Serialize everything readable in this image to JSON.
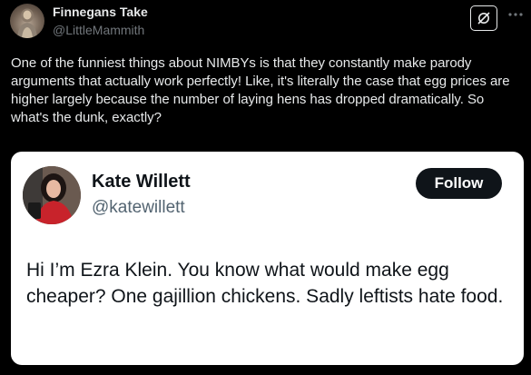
{
  "post": {
    "author_name": "Finnegans Take",
    "author_handle": "@LittleMammith",
    "text": "One of the funniest things about NIMBYs is that they constantly make parody arguments that actually work perfectly! Like, it's literally the case that egg prices are higher largely because the number of laying hens has dropped dramatically. So what's the dunk, exactly?",
    "icons": {
      "grok": "grok-icon",
      "more": "more-horizontal-icon",
      "avatar": "avatar"
    }
  },
  "quote": {
    "author_name": "Kate Willett",
    "author_handle": "@katewillett",
    "follow_label": "Follow",
    "text": "Hi I’m Ezra Klein. You know what would make egg cheaper? One gajillion chickens. Sadly leftists hate food."
  },
  "colors": {
    "background": "#000000",
    "primary_text": "#e7e9ea",
    "secondary_text": "#71767b",
    "card_background": "#ffffff",
    "card_text": "#0f1419",
    "card_secondary_text": "#536471",
    "follow_button": "#0f1419"
  }
}
